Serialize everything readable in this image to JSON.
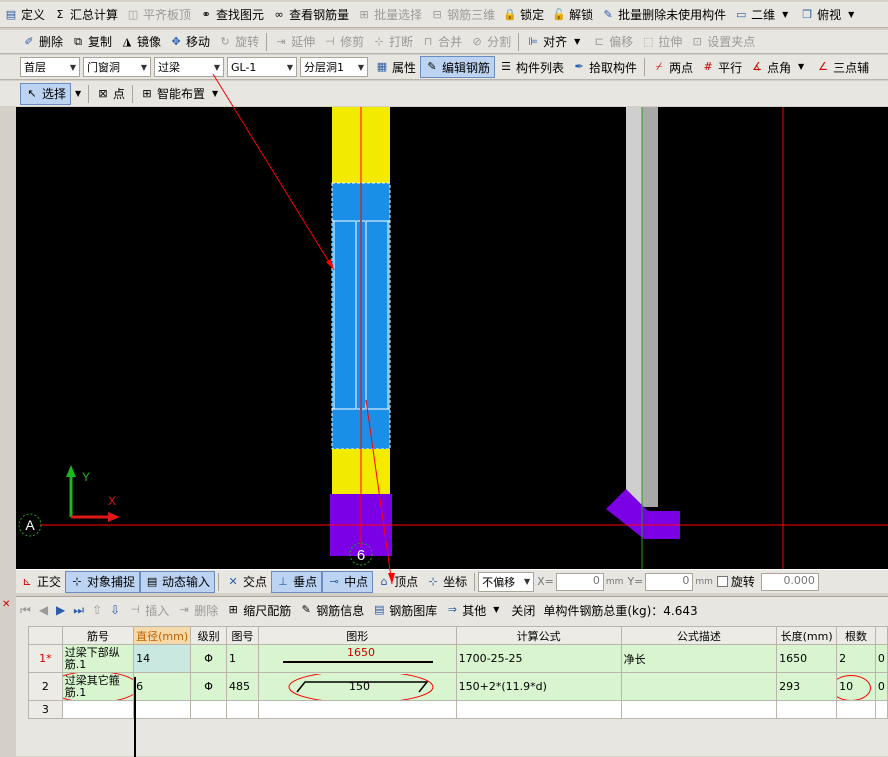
{
  "toolbar1": {
    "define": "定义",
    "summary": "汇总计算",
    "flat_slab_top": "平齐板顶",
    "find_element": "查找图元",
    "view_rebar": "查看钢筋量",
    "batch_select": "批量选择",
    "rebar_3d": "钢筋三维",
    "lock": "锁定",
    "unlock": "解锁",
    "batch_delete": "批量删除未使用构件",
    "view_mode": "二维",
    "view_dir": "俯视"
  },
  "toolbar2": {
    "delete": "删除",
    "copy": "复制",
    "mirror": "镜像",
    "move": "移动",
    "rotate": "旋转",
    "extend": "延伸",
    "trim": "修剪",
    "break": "打断",
    "merge": "合并",
    "split": "分割",
    "align": "对齐",
    "offset": "偏移",
    "stretch": "拉伸",
    "set_grip": "设置夹点"
  },
  "toolbar3": {
    "floor": "首层",
    "category": "门窗洞",
    "type": "过梁",
    "element": "GL-1",
    "layer": "分层洞1",
    "properties": "属性",
    "edit_rebar": "编辑钢筋",
    "element_list": "构件列表",
    "pick_element": "拾取构件",
    "two_points": "两点",
    "parallel": "平行",
    "point_angle": "点角",
    "three_point": "三点辅"
  },
  "toolbar4": {
    "select": "选择",
    "point": "点",
    "smart_layout": "智能布置"
  },
  "canvas": {
    "axis_y": "Y",
    "axis_x": "X",
    "grid_a": "A",
    "grid_6": "6"
  },
  "snapbar": {
    "ortho": "正交",
    "object_snap": "对象捕捉",
    "dynamic_input": "动态输入",
    "intersection": "交点",
    "perpendicular": "垂点",
    "midpoint": "中点",
    "vertex": "顶点",
    "coordinate": "坐标",
    "offset_mode": "不偏移",
    "x_label": "X=",
    "x_value": "0",
    "y_label": "Y=",
    "y_value": "0",
    "unit": "mm",
    "rotate_label": "旋转",
    "rotate_value": "0.000"
  },
  "panel": {
    "insert": "插入",
    "delete": "删除",
    "scale_rebar": "缩尺配筋",
    "rebar_info": "钢筋信息",
    "rebar_library": "钢筋图库",
    "other": "其他",
    "close": "关闭",
    "total_weight": "单构件钢筋总重(kg)：4.643"
  },
  "table": {
    "headers": [
      "筋号",
      "直径(mm)",
      "级别",
      "图号",
      "图形",
      "计算公式",
      "公式描述",
      "长度(mm)",
      "根数",
      ""
    ],
    "rows": [
      {
        "row": "1*",
        "name": "过梁下部纵筋.1",
        "diameter": "14",
        "grade": "Φ",
        "fig": "1",
        "shape_value": "1650",
        "formula": "1700-25-25",
        "desc": "净长",
        "length": "1650",
        "count": "2",
        "extra": "0"
      },
      {
        "row": "2",
        "name": "过梁其它箍筋.1",
        "diameter": "6",
        "grade": "Φ",
        "fig": "485",
        "shape_value": "150",
        "formula": "150+2*(11.9*d)",
        "desc": "",
        "length": "293",
        "count": "10",
        "extra": "0"
      },
      {
        "row": "3",
        "name": "",
        "diameter": "",
        "grade": "",
        "fig": "",
        "shape_value": "",
        "formula": "",
        "desc": "",
        "length": "",
        "count": "",
        "extra": ""
      }
    ]
  },
  "colors": {
    "beam_yellow": "#f2ea00",
    "beam_blue": "#1a8fe8",
    "column_purple": "#7b00e6",
    "annotation_red": "#ff0000",
    "grid_green": "#1aa31a"
  }
}
